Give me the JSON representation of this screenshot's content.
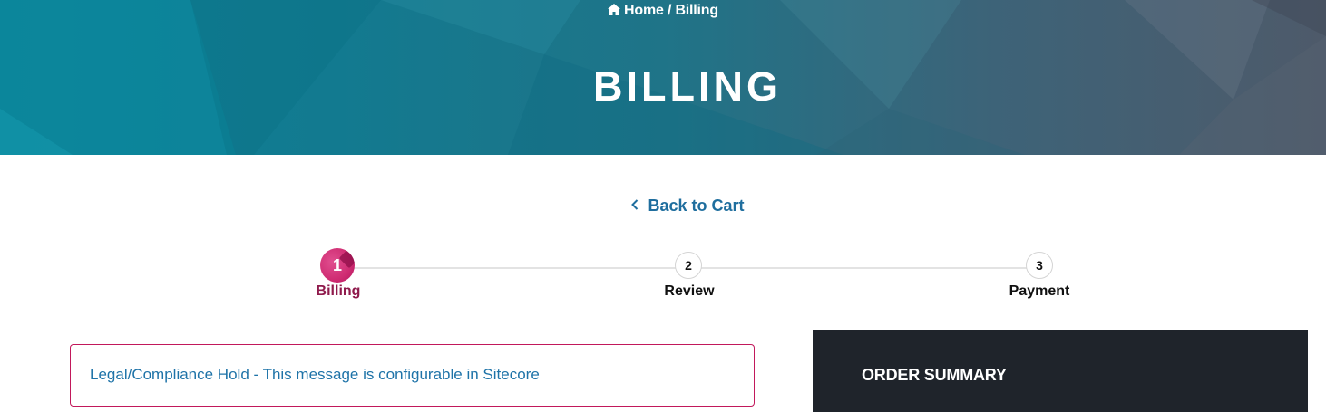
{
  "breadcrumb": {
    "icon": "home-icon",
    "home_label": "Home",
    "separator": "/",
    "current_label": "Billing"
  },
  "hero": {
    "title": "BILLING"
  },
  "back_link": {
    "icon": "chevron-left-icon",
    "label": "Back to Cart"
  },
  "stepper": {
    "steps": [
      {
        "number": "1",
        "label": "Billing",
        "active": true
      },
      {
        "number": "2",
        "label": "Review",
        "active": false
      },
      {
        "number": "3",
        "label": "Payment",
        "active": false
      }
    ]
  },
  "alert": {
    "message": "Legal/Compliance Hold - This message is configurable in Sitecore"
  },
  "order_summary": {
    "title": "ORDER SUMMARY"
  },
  "colors": {
    "link": "#1f6e9e",
    "accent_magenta": "#cf2c72",
    "active_step_label": "#8f1a4c",
    "alert_border": "#c2185b",
    "summary_bg": "#1f242b"
  }
}
